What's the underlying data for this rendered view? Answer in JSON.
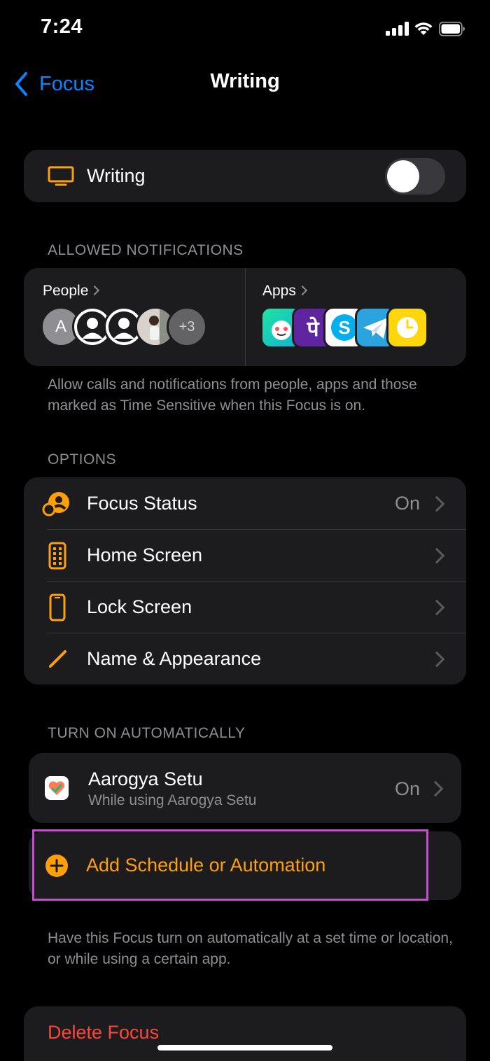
{
  "status_bar": {
    "time": "7:24"
  },
  "nav": {
    "back_label": "Focus",
    "title": "Writing"
  },
  "focus_toggle": {
    "label": "Writing",
    "enabled": false
  },
  "allowed_notifications": {
    "header": "ALLOWED NOTIFICATIONS",
    "people": {
      "label": "People",
      "avatar_initial": "A",
      "more_count": "+3"
    },
    "apps": {
      "label": "Apps",
      "app_icon_text_2": "पे",
      "app_icon_text_3": "S"
    },
    "footer": "Allow calls and notifications from people, apps and those marked as Time Sensitive when this Focus is on."
  },
  "options": {
    "header": "OPTIONS",
    "items": [
      {
        "label": "Focus Status",
        "value": "On"
      },
      {
        "label": "Home Screen",
        "value": ""
      },
      {
        "label": "Lock Screen",
        "value": ""
      },
      {
        "label": "Name & Appearance",
        "value": ""
      }
    ]
  },
  "turn_on_automatically": {
    "header": "TURN ON AUTOMATICALLY",
    "automation": {
      "title": "Aarogya Setu",
      "subtitle": "While using Aarogya Setu",
      "value": "On"
    },
    "add_label": "Add Schedule or Automation",
    "footer": "Have this Focus turn on automatically at a set time or location, or while using a certain app."
  },
  "delete": {
    "label": "Delete Focus"
  },
  "colors": {
    "accent": "#ff9f0a",
    "link": "#0a84ff",
    "destructive": "#ff453a",
    "highlight_box": "#c64fd1"
  }
}
